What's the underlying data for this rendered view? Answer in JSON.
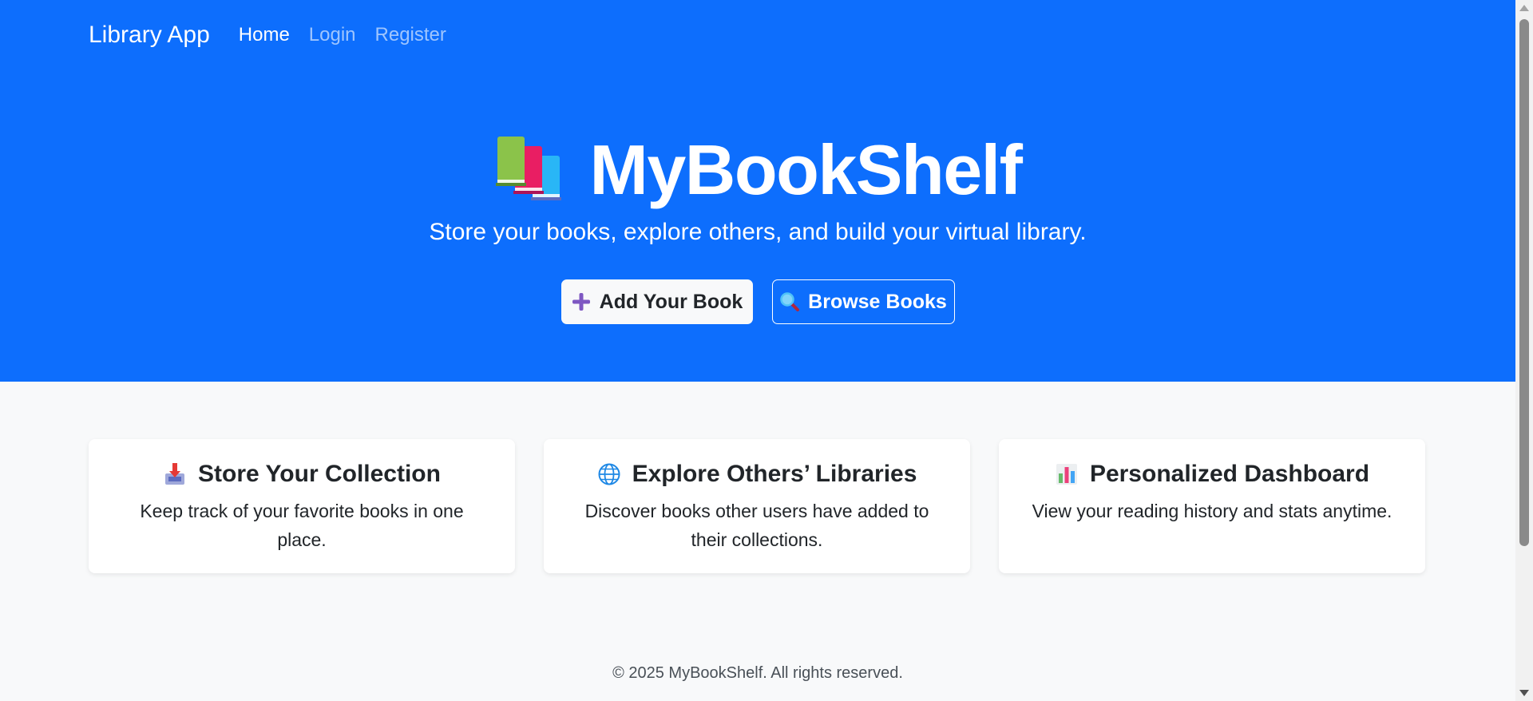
{
  "nav": {
    "brand": "Library App",
    "links": [
      {
        "label": "Home",
        "active": true
      },
      {
        "label": "Login",
        "active": false
      },
      {
        "label": "Register",
        "active": false
      }
    ]
  },
  "hero": {
    "icon": "books-icon",
    "title": "MyBookShelf",
    "subtitle": "Store your books, explore others, and build your virtual library.",
    "primary_button": {
      "icon": "plus-icon",
      "label": "Add Your Book"
    },
    "secondary_button": {
      "icon": "magnifier-icon",
      "label": "Browse Books"
    }
  },
  "features": [
    {
      "icon": "inbox-tray-icon",
      "title": "Store Your Collection",
      "text": "Keep track of your favorite books in one place."
    },
    {
      "icon": "globe-icon",
      "title": "Explore Others’ Libraries",
      "text": "Discover books other users have added to their collections."
    },
    {
      "icon": "bar-chart-icon",
      "title": "Personalized Dashboard",
      "text": "View your reading history and stats anytime."
    }
  ],
  "footer": {
    "text": "© 2025 MyBookShelf. All rights reserved."
  },
  "colors": {
    "primary": "#0d6efd",
    "page_bg": "#f8f9fa",
    "card_bg": "#ffffff",
    "text": "#212529"
  }
}
